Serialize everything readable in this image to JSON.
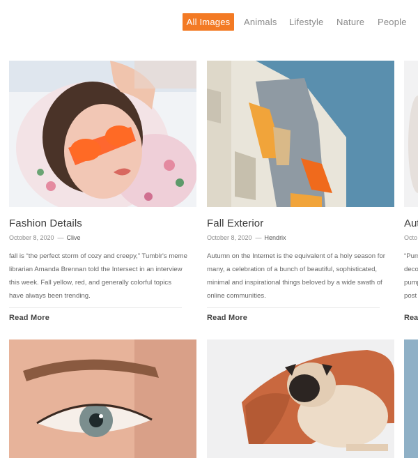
{
  "filters": [
    {
      "label": "All Images",
      "active": true
    },
    {
      "label": "Animals",
      "active": false
    },
    {
      "label": "Lifestyle",
      "active": false
    },
    {
      "label": "Nature",
      "active": false
    },
    {
      "label": "People",
      "active": false
    }
  ],
  "accent_color": "#f37a24",
  "cards": [
    {
      "title": "Fashion Details",
      "date": "October 8, 2020",
      "author": "Clive",
      "excerpt": "fall is “the perfect storm of cozy and creepy,” Tumblr's meme librarian Amanda Brennan told the Intersect in an interview this week. Fall yellow, red, and generally colorful topics have always been trending.",
      "read_more": "Read More",
      "image": "woman-orange-sunglasses-photo"
    },
    {
      "title": "Fall Exterior",
      "date": "October 8, 2020",
      "author": "Hendrix",
      "excerpt": "Autumn on the Internet is the equivalent of a holy season for many, a celebration of a bunch of beautiful, sophisticated, minimal and inspirational things beloved by a wide swath of online communities.",
      "read_more": "Read More",
      "image": "building-orange-awnings-photo"
    },
    {
      "title": "Aut",
      "date": "Octo",
      "excerpt_lines": [
        "“Pum",
        "deco",
        "pump",
        "post"
      ],
      "read_more": "Read",
      "image": "partial-photo"
    }
  ],
  "row2_images": [
    "eye-closeup-photo",
    "pug-on-blanket-photo",
    "partial-photo"
  ]
}
